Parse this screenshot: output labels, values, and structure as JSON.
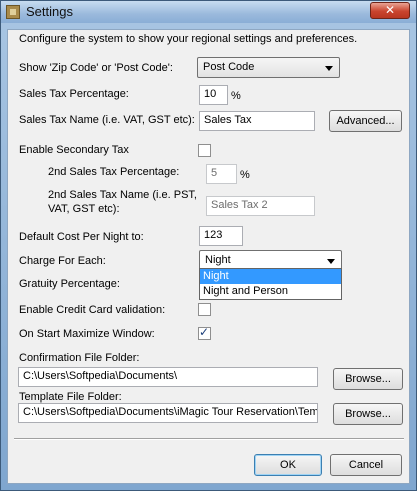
{
  "window": {
    "title": "Settings",
    "close_label": "✕"
  },
  "intro": "Configure the system to show your regional settings and preferences.",
  "zip": {
    "label": "Show 'Zip Code' or 'Post Code':",
    "value": "Post Code"
  },
  "sales_tax_pct": {
    "label": "Sales Tax Percentage:",
    "value": "10",
    "unit": "%"
  },
  "sales_tax_name": {
    "label": "Sales Tax Name (i.e. VAT, GST etc):",
    "value": "Sales Tax",
    "advanced_label": "Advanced..."
  },
  "secondary_tax": {
    "label": "Enable Secondary Tax",
    "checked": false
  },
  "second_tax_pct": {
    "label": "2nd Sales Tax Percentage:",
    "value": "5",
    "unit": "%"
  },
  "second_tax_name": {
    "label_line1": "2nd Sales Tax Name (i.e. PST,",
    "label_line2": "VAT, GST etc):",
    "value": "Sales Tax 2"
  },
  "default_cost": {
    "label": "Default Cost Per Night to:",
    "value": "123"
  },
  "charge_for": {
    "label": "Charge For Each:",
    "value": "Night",
    "options": [
      "Night",
      "Night and Person"
    ]
  },
  "gratuity": {
    "label": "Gratuity Percentage:"
  },
  "credit_card": {
    "label": "Enable Credit Card validation:",
    "checked": false
  },
  "maximize": {
    "label": "On Start Maximize Window:",
    "checked": true
  },
  "confirmation_folder": {
    "label": "Confirmation File Folder:",
    "value": "C:\\Users\\Softpedia\\Documents\\",
    "browse_label": "Browse..."
  },
  "template_folder": {
    "label": "Template File Folder:",
    "value": "C:\\Users\\Softpedia\\Documents\\iMagic Tour Reservation\\Tem",
    "browse_label": "Browse..."
  },
  "footer": {
    "ok_label": "OK",
    "cancel_label": "Cancel"
  }
}
